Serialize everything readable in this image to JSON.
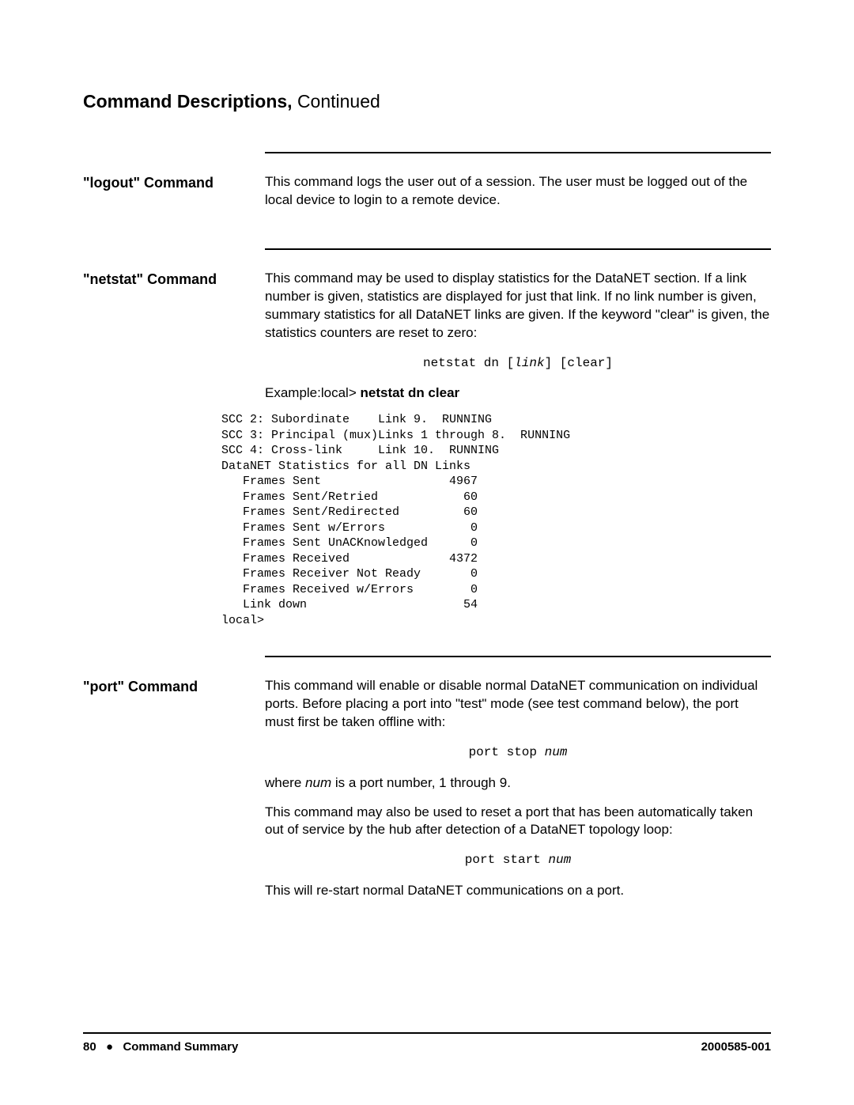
{
  "title": {
    "main": "Command Descriptions,",
    "cont": "Continued"
  },
  "sections": {
    "logout": {
      "heading": "\"logout\" Command",
      "body": "This command logs the user out of a session. The user must be logged out of the local device to login to a remote device."
    },
    "netstat": {
      "heading": "\"netstat\" Command",
      "body1": "This command may be used to display statistics for the DataNET section. If a link number is given, statistics are displayed for just that link. If no link number is given, summary statistics for all DataNET links are given. If the keyword \"clear\" is given, the statistics counters are reset to zero:",
      "syntax_pre": "netstat dn [",
      "syntax_italic": "link",
      "syntax_post": "] [clear]",
      "example_label": "Example:local> ",
      "example_cmd": "netstat dn clear",
      "output": "SCC 2: Subordinate    Link 9.  RUNNING\nSCC 3: Principal (mux)Links 1 through 8.  RUNNING\nSCC 4: Cross-link     Link 10.  RUNNING\nDataNET Statistics for all DN Links\n   Frames Sent                  4967\n   Frames Sent/Retried            60\n   Frames Sent/Redirected         60\n   Frames Sent w/Errors            0\n   Frames Sent UnACKnowledged      0\n   Frames Received              4372\n   Frames Receiver Not Ready       0\n   Frames Received w/Errors        0\n   Link down                      54\nlocal>"
    },
    "port": {
      "heading": "\"port\" Command",
      "body1": "This command will enable or disable normal DataNET communication on individual ports. Before placing a port into \"test\" mode (see test command below), the port must first be taken offline with:",
      "syntax1_pre": "port stop ",
      "syntax1_italic": "num",
      "body2a": "where ",
      "body2_italic": "num",
      "body2b": " is a port number, 1 through 9.",
      "body3": "This command may also be used to reset a port that has been automatically taken out of service by the hub after detection of a DataNET topology loop:",
      "syntax2_pre": "port start ",
      "syntax2_italic": "num",
      "body4": "This will re-start normal DataNET communications on a port."
    }
  },
  "footer": {
    "page": "80",
    "section": "Command Summary",
    "docnum": "2000585-001"
  }
}
